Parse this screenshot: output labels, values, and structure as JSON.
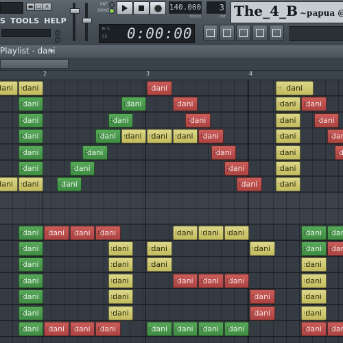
{
  "menu": [
    "S",
    "TOOLS",
    "HELP"
  ],
  "transport": {
    "pat_label": "PAT",
    "song_label": "SONG",
    "tempo_value": "140.000",
    "tempo_label": "TEMPO",
    "pattern_value": "3",
    "pattern_label": "PAT",
    "time_display": "0:00:00",
    "time_suffix_top": "M:S",
    "time_suffix_bottom": "CS"
  },
  "project_title": "The_4_B",
  "project_subtitle": "~papua @",
  "playlist": {
    "title": "Playlist - dani",
    "clip_label": "dani"
  },
  "ruler_bars": [
    "2",
    "3",
    "4"
  ],
  "colors": {
    "yellow": "#d2cc74",
    "green": "#4d9c50",
    "red": "#bd504d",
    "grid": "#343b42"
  }
}
